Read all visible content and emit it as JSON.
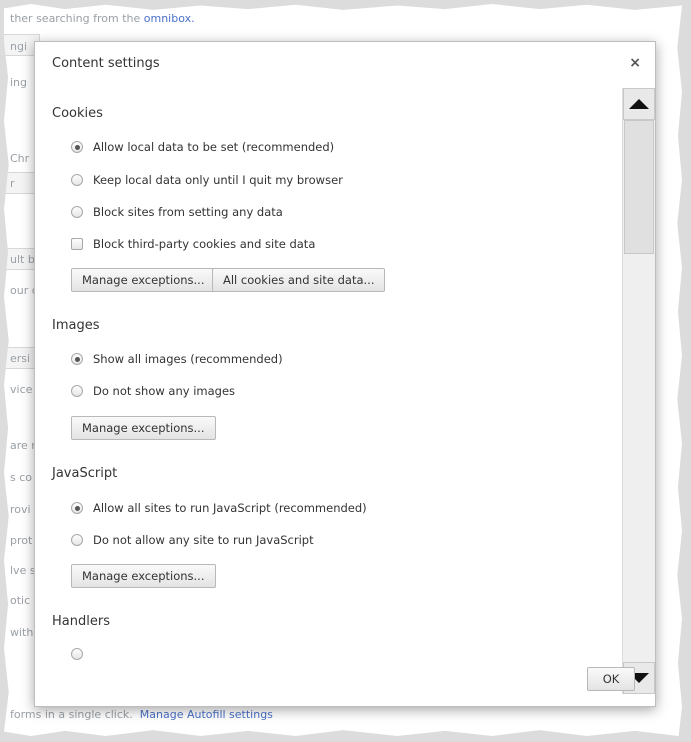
{
  "background": {
    "top_text": "ther searching from the",
    "top_link": "omnibox.",
    "fragments": [
      "ngi",
      "ing",
      "Chr",
      "r",
      "ult br",
      "our c",
      "ersi",
      "vice",
      "are n",
      "s co",
      "rovi",
      "prot",
      "lve s",
      "otic",
      "with"
    ],
    "bottom_text": "forms in a single click.",
    "bottom_link": "Manage Autofill settings"
  },
  "dialog": {
    "title": "Content settings",
    "close_glyph": "×",
    "ok_label": "OK"
  },
  "cookies": {
    "title": "Cookies",
    "options": [
      "Allow local data to be set (recommended)",
      "Keep local data only until I quit my browser",
      "Block sites from setting any data"
    ],
    "checkbox": "Block third-party cookies and site data",
    "buttons": [
      "Manage exceptions...",
      "All cookies and site data..."
    ]
  },
  "images": {
    "title": "Images",
    "options": [
      "Show all images (recommended)",
      "Do not show any images"
    ],
    "button": "Manage exceptions..."
  },
  "javascript": {
    "title": "JavaScript",
    "options": [
      "Allow all sites to run JavaScript (recommended)",
      "Do not allow any site to run JavaScript"
    ],
    "button": "Manage exceptions..."
  },
  "handlers": {
    "title": "Handlers"
  },
  "icons": {
    "radio": "radio-icon",
    "checkbox": "checkbox-icon",
    "scroll_up": "arrow-up-icon",
    "scroll_down": "arrow-down-icon",
    "close": "close-icon"
  }
}
